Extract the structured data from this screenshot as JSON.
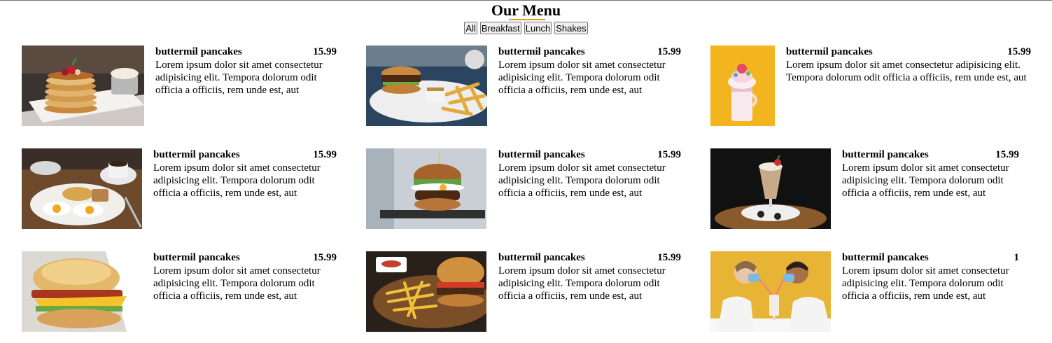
{
  "page": {
    "title": "Our Menu",
    "accent_color": "#d4a21a"
  },
  "filters": [
    {
      "label": "All"
    },
    {
      "label": "Breakfast"
    },
    {
      "label": "Lunch"
    },
    {
      "label": "Shakes"
    }
  ],
  "items": [
    {
      "name": "buttermil pancakes",
      "price": "15.99",
      "desc": "Lorem ipsum dolor sit amet consectetur adipisicing elit. Tempora dolorum odit officia a officiis, rem unde est, aut",
      "image": "pancake-stack-photo"
    },
    {
      "name": "buttermil pancakes",
      "price": "15.99",
      "desc": "Lorem ipsum dolor sit amet consectetur adipisicing elit. Tempora dolorum odit officia a officiis, rem unde est, aut",
      "image": "burger-and-fries-photo"
    },
    {
      "name": "buttermil pancakes",
      "price": "15.99",
      "desc": "Lorem ipsum dolor sit amet consectetur adipisicing elit. Tempora dolorum odit officia a officiis, rem unde est, aut",
      "image": "freakshake-photo"
    },
    {
      "name": "buttermil pancakes",
      "price": "15.99",
      "desc": "Lorem ipsum dolor sit amet consectetur adipisicing elit. Tempora dolorum odit officia a officiis, rem unde est, aut",
      "image": "breakfast-plate-photo"
    },
    {
      "name": "buttermil pancakes",
      "price": "15.99",
      "desc": "Lorem ipsum dolor sit amet consectetur adipisicing elit. Tempora dolorum odit officia a officiis, rem unde est, aut",
      "image": "egg-burger-photo"
    },
    {
      "name": "buttermil pancakes",
      "price": "15.99",
      "desc": "Lorem ipsum dolor sit amet consectetur adipisicing elit. Tempora dolorum odit officia a officiis, rem unde est, aut",
      "image": "milkshake-photo"
    },
    {
      "name": "buttermil pancakes",
      "price": "15.99",
      "desc": "Lorem ipsum dolor sit amet consectetur adipisicing elit. Tempora dolorum odit officia a officiis, rem unde est, aut",
      "image": "biscuit-sandwich-photo"
    },
    {
      "name": "buttermil pancakes",
      "price": "15.99",
      "desc": "Lorem ipsum dolor sit amet consectetur adipisicing elit. Tempora dolorum odit officia a officiis, rem unde est, aut",
      "image": "burger-fries-board-photo"
    },
    {
      "name": "buttermil pancakes",
      "price": "1",
      "desc": "Lorem ipsum dolor sit amet consectetur adipisicing elit. Tempora dolorum odit officia a officiis, rem unde est, aut",
      "image": "couple-sharing-shake-photo"
    }
  ]
}
